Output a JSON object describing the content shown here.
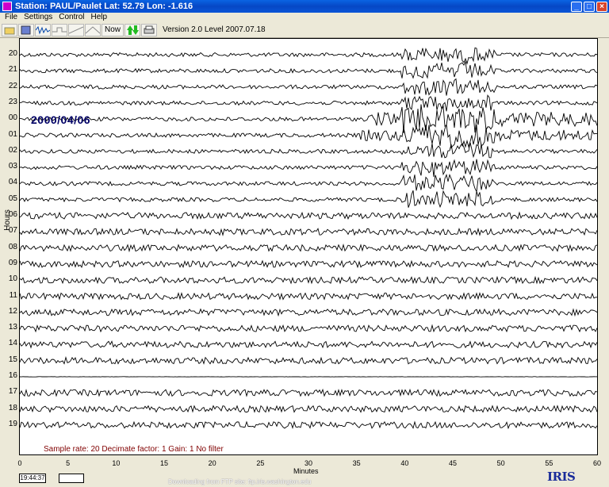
{
  "window": {
    "title": "Station: PAUL/Paulet Lat: 52.79 Lon: -1.616",
    "min_label": "_",
    "max_label": "□",
    "close_label": "×"
  },
  "menu": {
    "items": [
      "File",
      "Settings",
      "Control",
      "Help"
    ]
  },
  "toolbar": {
    "now_label": "Now",
    "version": "Version 2.0 Level 2007.07.18"
  },
  "plot": {
    "date": "2000/04/06",
    "info": "Sample rate: 20   Decimate factor: 1   Gain: 1   No filter",
    "hour_labels": [
      "20",
      "21",
      "22",
      "23",
      "00",
      "01",
      "02",
      "03",
      "04",
      "05",
      "06",
      "07",
      "08",
      "09",
      "10",
      "11",
      "12",
      "13",
      "14",
      "15",
      "16",
      "17",
      "18",
      "19"
    ],
    "y_axis_title": "Hours",
    "x_ticks": [
      "0",
      "5",
      "10",
      "15",
      "20",
      "25",
      "30",
      "35",
      "40",
      "45",
      "50",
      "55",
      "60"
    ],
    "x_axis_title": "Minutes",
    "x_range": [
      0,
      60
    ],
    "quake_start_minute": 36,
    "flat_hour_index": 20
  },
  "status": {
    "time": "19:44:37",
    "message": "Downloading from FTP site: ftp.iris.washington.edu",
    "logo": "IRIS"
  },
  "colors": {
    "trace": "#000000",
    "date": "#000066",
    "info": "#800000",
    "logo": "#1a2c9a"
  }
}
